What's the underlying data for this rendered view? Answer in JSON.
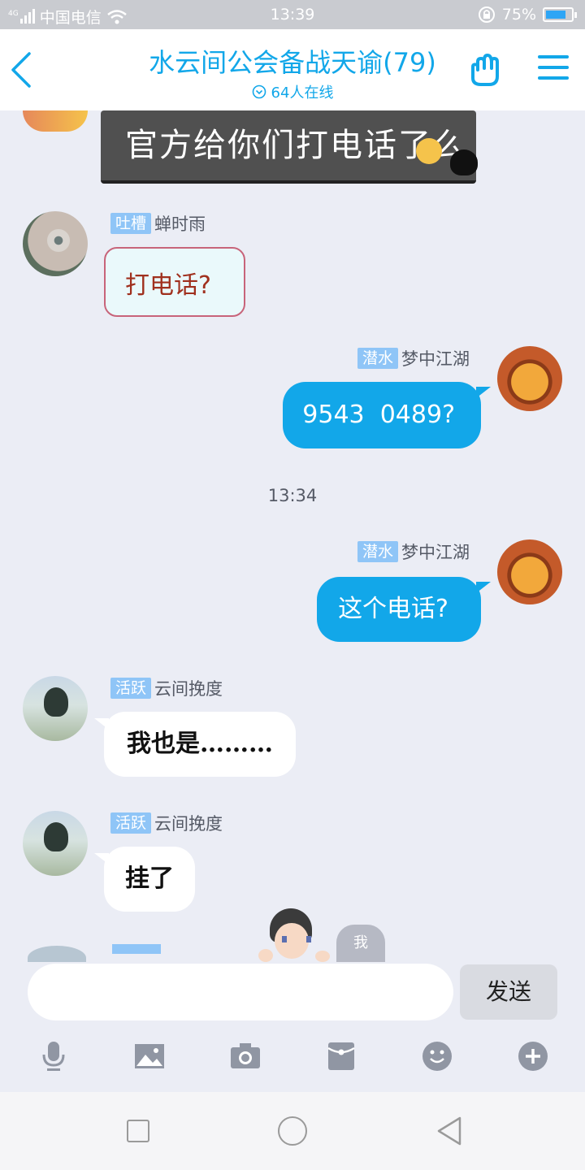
{
  "status_bar": {
    "network": "4G",
    "carrier": "中国电信",
    "time": "13:39",
    "battery": "75%"
  },
  "header": {
    "title": "水云间公会备战天谕(79)",
    "online": "64人在线"
  },
  "sticker": {
    "board_text": "官方给你们打电话了么"
  },
  "messages": [
    {
      "tag": "吐槽",
      "name": "蝉时雨",
      "text": "打电话?",
      "side": "left"
    },
    {
      "tag": "潜水",
      "name": "梦中江湖",
      "text": "9543  0489?",
      "side": "right"
    },
    {
      "tag": "潜水",
      "name": "梦中江湖",
      "text": "这个电话?",
      "side": "right"
    },
    {
      "tag": "活跃",
      "name": "云间挽度",
      "text": "我也是………",
      "side": "left"
    },
    {
      "tag": "活跃",
      "name": "云间挽度",
      "text": "挂了",
      "side": "left"
    }
  ],
  "timestamp": "13:34",
  "mascot": {
    "bubble_text": "我"
  },
  "input": {
    "placeholder": "",
    "send_label": "发送"
  },
  "toolbar": [
    "mic-icon",
    "image-icon",
    "camera-icon",
    "redpacket-icon",
    "emoji-icon",
    "plus-icon"
  ],
  "colors": {
    "accent": "#12a7e9",
    "tag": "#8fc5f7",
    "background": "#ebedf5"
  }
}
